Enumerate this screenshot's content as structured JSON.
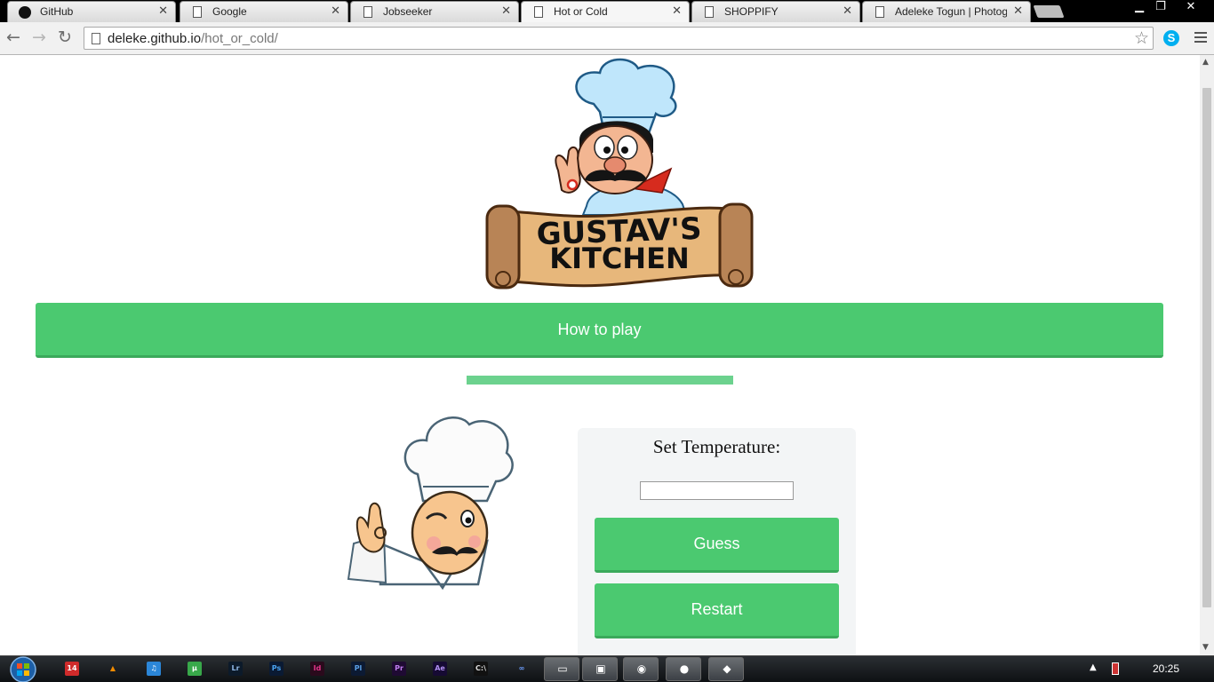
{
  "browser": {
    "tabs": [
      {
        "label": "GitHub",
        "icon": "github-icon",
        "active": false
      },
      {
        "label": "Google",
        "icon": "page-icon",
        "active": false
      },
      {
        "label": "Jobseeker",
        "icon": "page-icon",
        "active": false
      },
      {
        "label": "Hot or Cold",
        "icon": "page-icon",
        "active": true
      },
      {
        "label": "SHOPPIFY",
        "icon": "page-icon",
        "active": false
      },
      {
        "label": "Adeleke Togun | Photogra",
        "icon": "page-icon",
        "active": false
      }
    ],
    "tab_close": "✕",
    "window_controls": {
      "minimize": "▁",
      "restore": "❐",
      "close": "✕"
    },
    "nav": {
      "back": "←",
      "forward": "→",
      "reload": "↻"
    },
    "url_host": "deleke.github.io",
    "url_path": "/hot_or_cold/",
    "star_icon": "☆",
    "skype_letter": "S"
  },
  "page": {
    "how_to_play": "How to play",
    "progress": 1.0,
    "panel": {
      "title": "Set Temperature:",
      "input_value": "",
      "guess_label": "Guess",
      "restart_label": "Restart"
    },
    "colors": {
      "accent": "#4bc970",
      "progress": "#6cd28e"
    }
  },
  "taskbar": {
    "pinned": [
      {
        "name": "badge-14-icon",
        "text": "14",
        "bg": "#cf2b2b",
        "fg": "#fff"
      },
      {
        "name": "vlc-icon",
        "text": "▲",
        "bg": "transparent",
        "fg": "#f28c00"
      },
      {
        "name": "itunes-icon",
        "text": "♫",
        "bg": "#2b86d8",
        "fg": "#fff"
      },
      {
        "name": "utorrent-icon",
        "text": "µ",
        "bg": "#38a84a",
        "fg": "#fff"
      },
      {
        "name": "lightroom-icon",
        "text": "Lr",
        "bg": "#0c1a2a",
        "fg": "#8fb7e4"
      },
      {
        "name": "photoshop-icon",
        "text": "Ps",
        "bg": "#0a1a33",
        "fg": "#4aa3f0"
      },
      {
        "name": "indesign-icon",
        "text": "Id",
        "bg": "#2a0a1c",
        "fg": "#e4338a"
      },
      {
        "name": "prelude-icon",
        "text": "Pl",
        "bg": "#0c1a33",
        "fg": "#5a9fe6"
      },
      {
        "name": "premiere-icon",
        "text": "Pr",
        "bg": "#1f0a33",
        "fg": "#c07ef0"
      },
      {
        "name": "aftereffects-icon",
        "text": "Ae",
        "bg": "#160a33",
        "fg": "#b08ef0"
      },
      {
        "name": "cmd-icon",
        "text": "C:\\",
        "bg": "#111",
        "fg": "#ddd"
      },
      {
        "name": "infinity-icon",
        "text": "∞",
        "bg": "transparent",
        "fg": "#6fa0ff"
      }
    ],
    "running": [
      {
        "name": "explorer-icon",
        "text": "▭"
      },
      {
        "name": "media-icon",
        "text": "▣"
      },
      {
        "name": "chrome-icon",
        "text": "◉"
      },
      {
        "name": "chat-icon",
        "text": "●"
      },
      {
        "name": "messenger-icon",
        "text": "◆"
      }
    ],
    "tray_arrow": "▲",
    "clock": "20:25"
  }
}
